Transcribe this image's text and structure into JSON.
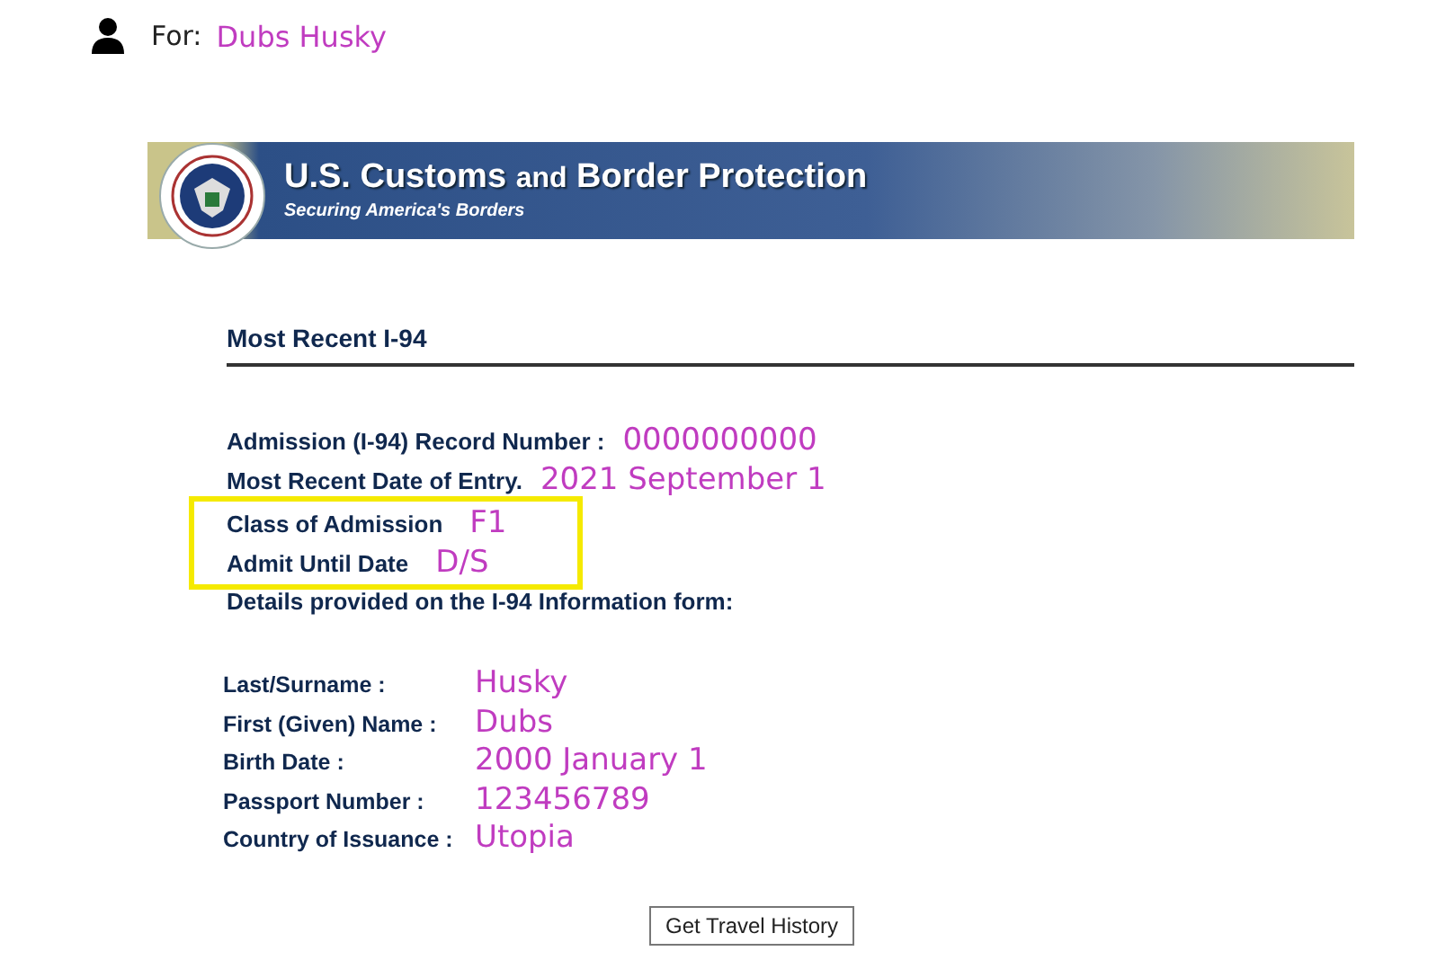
{
  "for_line": {
    "label": "For:",
    "name": "Dubs Husky"
  },
  "banner": {
    "title_parts": [
      "U.S. Customs",
      "and",
      "Border Protection"
    ],
    "tagline": "Securing America's Borders"
  },
  "section_title": "Most Recent I-94",
  "records": [
    {
      "label": "Admission (I-94) Record Number :",
      "value": "0000000000",
      "highlighted": false
    },
    {
      "label": "Most Recent Date of Entry.",
      "value": "2021 September 1",
      "highlighted": false
    },
    {
      "label": "Class of Admission",
      "value": "F1",
      "highlighted": true
    },
    {
      "label": "Admit Until Date",
      "value": "D/S",
      "highlighted": true
    }
  ],
  "details_intro": "Details provided on the I-94 Information form:",
  "details": [
    {
      "label": "Last/Surname :",
      "value": "Husky"
    },
    {
      "label": "First (Given) Name :",
      "value": "Dubs"
    },
    {
      "label": "Birth Date :",
      "value": "2000 January 1"
    },
    {
      "label": "Passport Number :",
      "value": "123456789"
    },
    {
      "label": "Country of Issuance :",
      "value": "Utopia"
    }
  ],
  "button": "Get Travel History"
}
